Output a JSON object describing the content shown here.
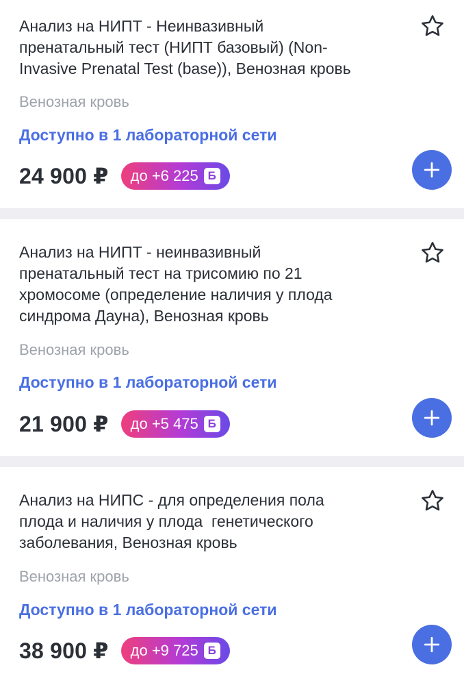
{
  "items": [
    {
      "title": "Анализ на НИПТ - Неинвазивный\nпренатальный тест (НИПТ базовый) (Non-\nInvasive Prenatal Test (base)), Венозная кровь",
      "sample_type": "Венозная кровь",
      "availability": "Доступно в 1 лабораторной сети",
      "price": "24 900 ₽",
      "bonus": "до +6 225",
      "bonus_icon_letter": "Б"
    },
    {
      "title": "Анализ на НИПТ - неинвазивный\nпренатальный тест на трисомию по 21\nхромосоме (определение наличия у плода\nсиндрома Дауна), Венозная кровь",
      "sample_type": "Венозная кровь",
      "availability": "Доступно в 1 лабораторной сети",
      "price": "21 900 ₽",
      "bonus": "до +5 475",
      "bonus_icon_letter": "Б"
    },
    {
      "title": "Анализ на НИПС - для определения пола\nплода и наличия у плода  генетического\nзаболевания, Венозная кровь",
      "sample_type": "Венозная кровь",
      "availability": "Доступно в 1 лабораторной сети",
      "price": "38 900 ₽",
      "bonus": "до +9 725",
      "bonus_icon_letter": "Б"
    }
  ],
  "icons": {
    "favorite": "star-outline-icon",
    "add": "plus-icon"
  },
  "colors": {
    "accent": "#4a6fe3",
    "text": "#2b2f36",
    "muted": "#9ea2aa",
    "badge_gradient": [
      "#ee3f7c",
      "#b33bd6",
      "#6a4ae6"
    ],
    "background": "#efeff3"
  }
}
